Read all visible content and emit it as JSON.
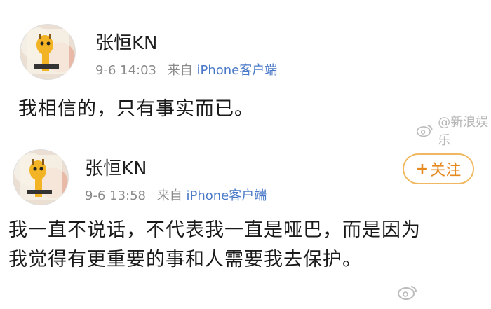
{
  "posts": [
    {
      "username": "张恒KN",
      "date": "9-6 14:03",
      "source_prefix": "来自",
      "source_device": "iPhone客户端",
      "content": "我相信的，只有事实而已。",
      "watermark": "@新浪娱乐"
    },
    {
      "username": "张恒KN",
      "date": "9-6 13:58",
      "source_prefix": "来自",
      "source_device": "iPhone客户端",
      "content_line1": "我一直不说话，不代表我一直是哑巴，而是因为",
      "content_line2": "我觉得有更重要的事和人需要我去保护。",
      "follow_label": "关注",
      "follow_plus": "+"
    }
  ],
  "icons": {
    "weibo": "weibo-logo-icon",
    "follow": "plus-icon"
  },
  "colors": {
    "source_link": "#4a79c8",
    "follow_border": "#f0b860",
    "follow_text": "#e58a1f",
    "meta_gray": "#8a8a8a"
  }
}
